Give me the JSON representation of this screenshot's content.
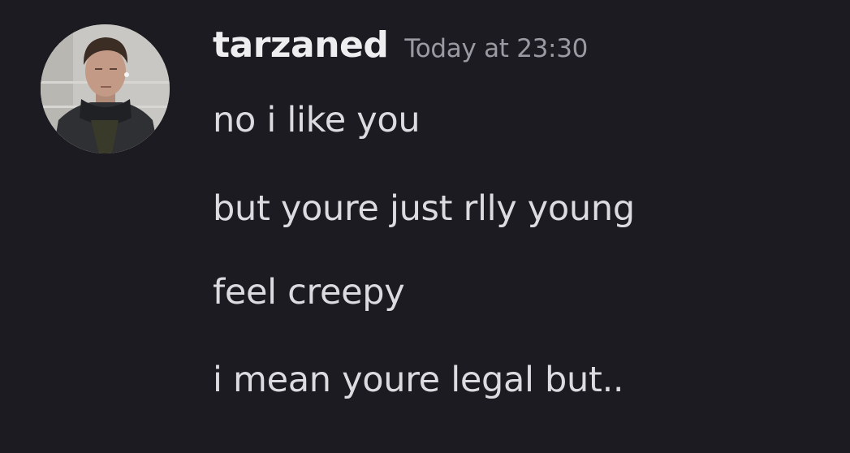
{
  "message": {
    "username": "tarzaned",
    "timestamp": "Today at 23:30",
    "avatar_icon": "user-profile-photo",
    "lines": [
      "no i like you",
      "but youre just rlly young",
      "feel creepy",
      "i mean youre legal but.."
    ]
  },
  "colors": {
    "background": "#1c1b21",
    "username": "#eeeef0",
    "timestamp": "#9a9aa3",
    "text": "#dcdce0"
  }
}
